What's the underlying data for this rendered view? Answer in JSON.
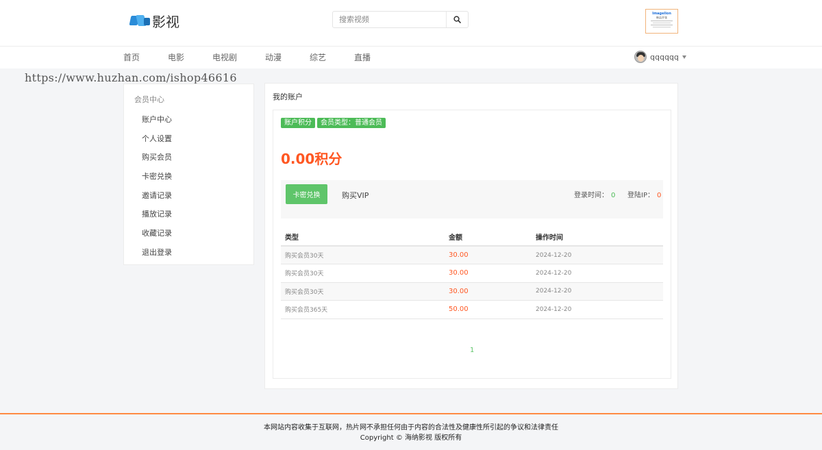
{
  "header": {
    "logo_text": "影视",
    "search": {
      "placeholder": "搜索视频"
    },
    "qr": {
      "line1": "Imagelion",
      "line2": "新店开张"
    }
  },
  "nav": {
    "items": [
      "首页",
      "电影",
      "电视剧",
      "动漫",
      "综艺",
      "直播"
    ],
    "username": "qqqqqq"
  },
  "watermark": "https://www.huzhan.com/ishop46616",
  "sidebar": {
    "title": "会员中心",
    "links": [
      "账户中心",
      "个人设置",
      "购买会员",
      "卡密兑换",
      "邀请记录",
      "播放记录",
      "收藏记录",
      "退出登录"
    ]
  },
  "main": {
    "title": "我的账户",
    "tags": [
      "账户积分",
      "会员类型：普通会员"
    ],
    "points": "0.00积分",
    "buttons": {
      "card": "卡密兑换",
      "vip": "购买VIP"
    },
    "login_time_label": "登录时间：",
    "login_time_value": "0",
    "login_ip_label": "登陆IP：",
    "login_ip_value": "0",
    "table": {
      "headers": [
        "类型",
        "金额",
        "操作时间"
      ],
      "rows": [
        [
          "购买会员30天",
          "30.00",
          "2024-12-20"
        ],
        [
          "购买会员30天",
          "30.00",
          "2024-12-20"
        ],
        [
          "购买会员30天",
          "30.00",
          "2024-12-20"
        ],
        [
          "购买会员365天",
          "50.00",
          "2024-12-20"
        ]
      ]
    },
    "page": "1"
  },
  "footer": {
    "line1": "本网站内容收集于互联网，热片网不承担任何由于内容的合法性及健康性所引起的争议和法律责任",
    "line2": "Copyright ©  海纳影视 版权所有"
  },
  "colors": {
    "accent_green": "#4cbb57",
    "accent_orange": "#ff5722",
    "footer_line": "#ff8a42"
  }
}
